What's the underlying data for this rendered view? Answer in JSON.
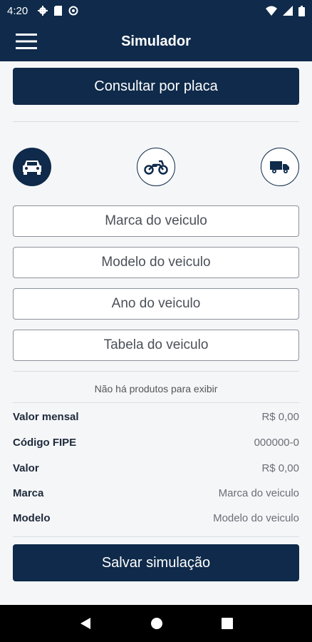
{
  "status": {
    "time": "4:20"
  },
  "appbar": {
    "title": "Simulador"
  },
  "plate_button": "Consultar por placa",
  "vehicle_types": {
    "active": "car-icon"
  },
  "fields": {
    "marca": "Marca do veiculo",
    "modelo": "Modelo do veiculo",
    "ano": "Ano do veiculo",
    "tabela": "Tabela do veiculo"
  },
  "empty_message": "Não há produtos para exibir",
  "summary": [
    {
      "label": "Valor mensal",
      "value": "R$ 0,00"
    },
    {
      "label": "Código FIPE",
      "value": "000000-0"
    },
    {
      "label": "Valor",
      "value": "R$ 0,00"
    },
    {
      "label": "Marca",
      "value": "Marca do veiculo"
    },
    {
      "label": "Modelo",
      "value": "Modelo do veiculo"
    }
  ],
  "save_button": "Salvar simulação",
  "colors": {
    "primary": "#0f2a4a",
    "background": "#f5f6f8"
  }
}
